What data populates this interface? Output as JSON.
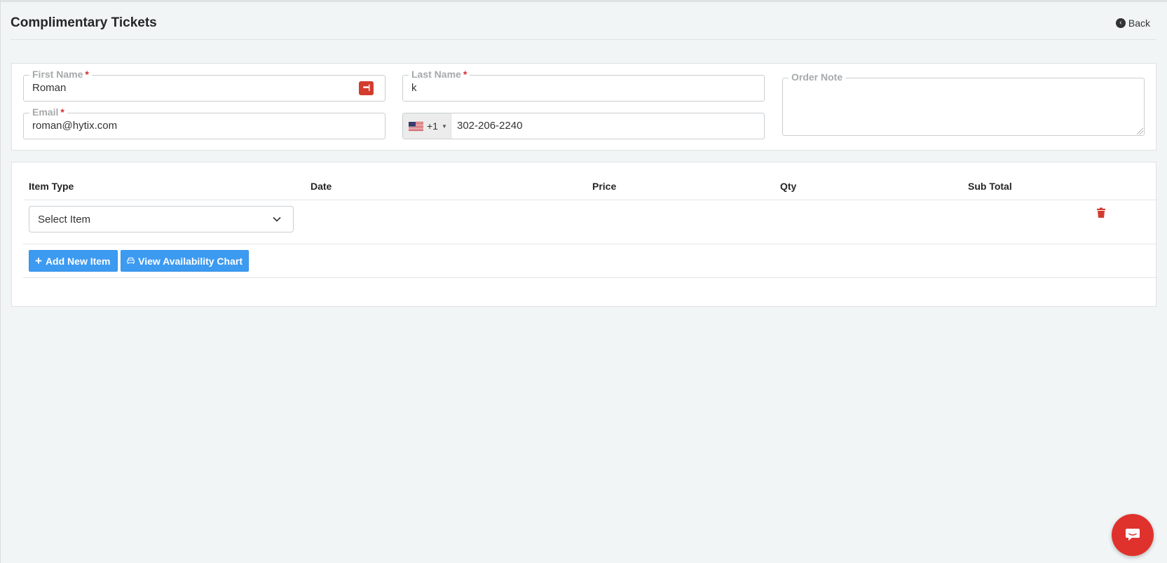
{
  "page": {
    "title": "Complimentary Tickets",
    "back_label": "Back"
  },
  "customer": {
    "first_name": {
      "label": "First Name",
      "required_mark": "*",
      "value": "Roman"
    },
    "last_name": {
      "label": "Last Name",
      "required_mark": "*",
      "value": "k"
    },
    "email": {
      "label": "Email",
      "required_mark": "*",
      "value": "roman@hytix.com"
    },
    "phone": {
      "country_code": "+1",
      "value": "302-206-2240"
    },
    "order_note": {
      "label": "Order Note",
      "value": ""
    }
  },
  "items_table": {
    "columns": [
      "Item Type",
      "Date",
      "Price",
      "Qty",
      "Sub Total"
    ],
    "rows": [
      {
        "item_select": "Select Item"
      }
    ]
  },
  "actions": {
    "add_item_label": "Add New Item",
    "availability_label": "View Availability Chart"
  },
  "colors": {
    "primary_button": "#3c9af1",
    "danger": "#d23c2f",
    "required": "#d72d2d",
    "page_background": "#f1f5f5"
  },
  "icons": {
    "back": "circle-chevron-left-icon",
    "password_manager": "password-manager-icon",
    "flag": "us-flag-icon",
    "dropdown": "chevron-down-icon",
    "delete": "trash-icon",
    "add": "plus-icon",
    "chart": "couch-icon",
    "chat": "chat-icon"
  }
}
